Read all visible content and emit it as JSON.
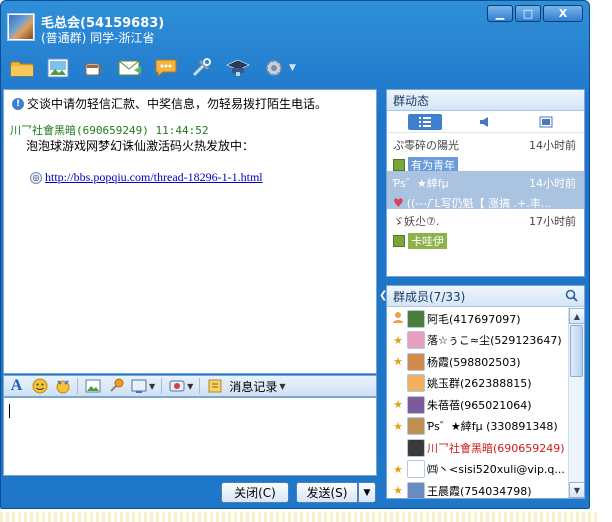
{
  "window": {
    "title_name": "毛总会(54159683)",
    "title_sub": "(普通群) 同学-浙江省",
    "minimize_glyph": "▁",
    "maximize_glyph": "□",
    "close_glyph": "X"
  },
  "chat": {
    "notice": "交谈中请勿轻信汇款、中奖信息，勿轻易拨打陌生电话。",
    "message_header": "川乛社會黑暗(690659249)  11:44:52",
    "message_text": "泡泡球游戏网梦幻诛仙激活码火热发放中：",
    "message_link": "http://bbs.popqiu.com/thread-18296-1-1.html"
  },
  "input_toolbar": {
    "font_glyph": "A",
    "history_label": "消息记录"
  },
  "buttons": {
    "close_label": "关闭(C)",
    "send_label": "发送(S)",
    "send_dropdown": "▼"
  },
  "group_dynamics": {
    "title": "群动态",
    "items": [
      {
        "user": "ぷ零碎の陽光",
        "time": "14小时前",
        "tag": "有为青年",
        "kind": "tag"
      },
      {
        "user": "Ƥѕ゛★緈fμ",
        "time": "14小时前",
        "message": "((---/ ̄L写仍魁【 涨搞 .+.丰...",
        "kind": "heart"
      },
      {
        "user": "ゞ妖尐⑦.",
        "time": "17小时前",
        "tag": "卡哇伊",
        "kind": "tag-green"
      }
    ]
  },
  "members": {
    "title": "群成员(7/33)",
    "list": [
      {
        "name": "阿毛(417697097)",
        "mark": "",
        "role": "owner",
        "color": "#4a7d3a"
      },
      {
        "name": "落☆ぅこ≈尘(529123647)",
        "mark": "★",
        "role": "admin",
        "color": "#e9a0c0"
      },
      {
        "name": "杨霞(598802503)",
        "mark": "★",
        "role": "admin",
        "color": "#d28a4a"
      },
      {
        "name": "姚玉群(262388815)",
        "mark": "",
        "role": "member",
        "color": "#f0b060"
      },
      {
        "name": "朱蓓蓓(965021064)",
        "mark": "★",
        "role": "admin",
        "color": "#7d5a9a"
      },
      {
        "name": "Ƥѕ゛★緈fμ (330891348)",
        "mark": "★",
        "role": "admin",
        "color": "#c09050"
      },
      {
        "name": "川乛社會黑暗(690659249)",
        "mark": "",
        "role": "member",
        "color": "#3a3a3a",
        "red": true
      },
      {
        "name": "㈣丶<sisi520xuli@vip.q...",
        "mark": "★",
        "role": "admin",
        "color": "#ffffff"
      },
      {
        "name": "王晨霞(754034798)",
        "mark": "★",
        "role": "admin",
        "color": "#6a8ac0"
      }
    ]
  }
}
